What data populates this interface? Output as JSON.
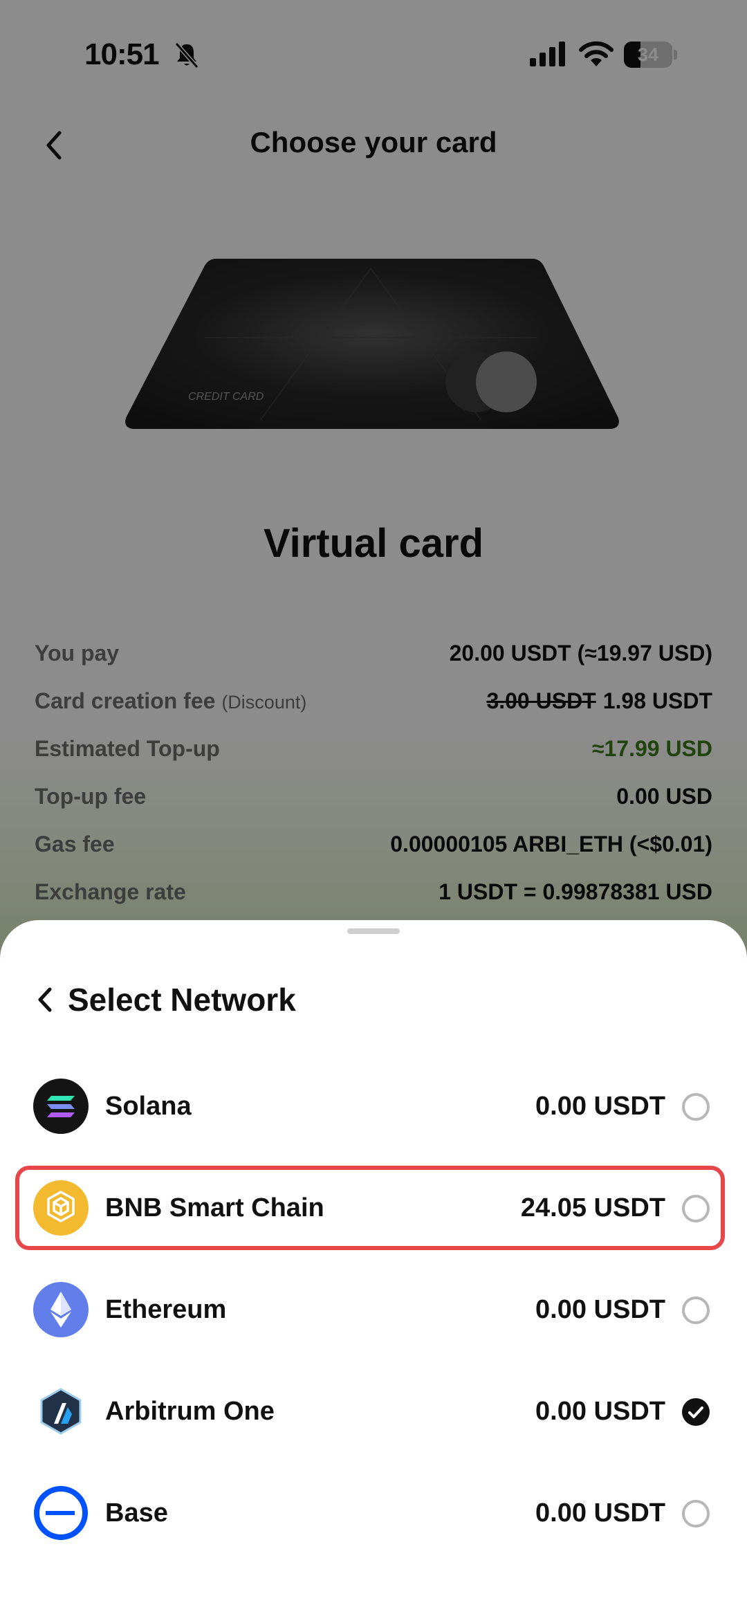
{
  "status_bar": {
    "time": "10:51",
    "battery_level": "34",
    "battery_fraction": 0.34
  },
  "header": {
    "title": "Choose your card"
  },
  "card": {
    "card_text": "CREDIT CARD",
    "title": "Virtual card"
  },
  "details": [
    {
      "label": "You pay",
      "sub": "",
      "value": "20.00 USDT (≈19.97 USD)",
      "old_value": ""
    },
    {
      "label": "Card creation fee",
      "sub": "(Discount)",
      "value": "1.98 USDT",
      "old_value": "3.00 USDT"
    },
    {
      "label": "Estimated Top-up",
      "sub": "",
      "value": "≈17.99 USD",
      "old_value": ""
    },
    {
      "label": "Top-up fee",
      "sub": "",
      "value": "0.00 USD",
      "old_value": ""
    },
    {
      "label": "Gas fee",
      "sub": "",
      "value": "0.00000105 ARBI_ETH (<$0.01)",
      "old_value": ""
    },
    {
      "label": "Exchange rate",
      "sub": "",
      "value": "1 USDT = 0.99878381 USD",
      "old_value": ""
    }
  ],
  "sheet": {
    "title": "Select Network",
    "networks": [
      {
        "name": "Solana",
        "balance": "0.00 USDT",
        "icon": "solana-icon",
        "selected": false,
        "highlighted": false
      },
      {
        "name": "BNB Smart Chain",
        "balance": "24.05 USDT",
        "icon": "bnb-icon",
        "selected": false,
        "highlighted": true
      },
      {
        "name": "Ethereum",
        "balance": "0.00 USDT",
        "icon": "ethereum-icon",
        "selected": false,
        "highlighted": false
      },
      {
        "name": "Arbitrum One",
        "balance": "0.00 USDT",
        "icon": "arbitrum-icon",
        "selected": true,
        "highlighted": false
      },
      {
        "name": "Base",
        "balance": "0.00 USDT",
        "icon": "base-icon",
        "selected": false,
        "highlighted": false
      }
    ]
  },
  "colors": {
    "highlight_border": "#e8474a",
    "discount_green": "#3d7d1a",
    "bnb_yellow": "#f3ba2f",
    "ethereum_blue": "#627eea",
    "base_blue": "#0052ff",
    "arbitrum_navy": "#213147",
    "arbitrum_blue": "#28a0f0"
  }
}
